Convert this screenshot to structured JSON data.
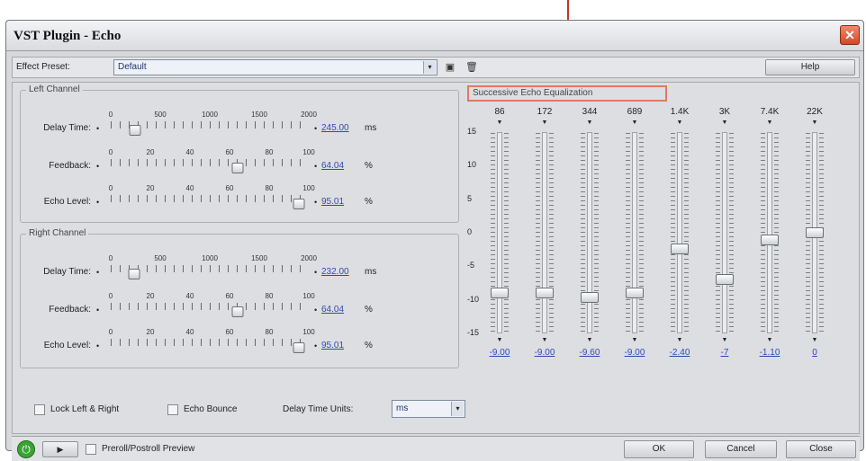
{
  "window": {
    "title": "VST Plugin - Echo",
    "close_glyph": "✕"
  },
  "preset": {
    "label": "Effect Preset:",
    "value": "Default",
    "arrow": "▾",
    "save_icon": "▣",
    "delete_icon": "🗑",
    "help_label": "Help"
  },
  "left_channel": {
    "title": "Left Channel",
    "delay": {
      "label": "Delay Time:",
      "scale": [
        "0",
        "500",
        "1000",
        "1500",
        "2000"
      ],
      "value": "245.00",
      "unit": "ms",
      "level": 0.1225
    },
    "feedback": {
      "label": "Feedback:",
      "scale": [
        "0",
        "20",
        "40",
        "60",
        "80",
        "100"
      ],
      "value": "64.04",
      "unit": "%",
      "level": 0.6404
    },
    "echo_level": {
      "label": "Echo Level:",
      "scale": [
        "0",
        "20",
        "40",
        "60",
        "80",
        "100"
      ],
      "value": "95.01",
      "unit": "%",
      "level": 0.9501
    }
  },
  "right_channel": {
    "title": "Right Channel",
    "delay": {
      "label": "Delay Time:",
      "scale": [
        "0",
        "500",
        "1000",
        "1500",
        "2000"
      ],
      "value": "232.00",
      "unit": "ms",
      "level": 0.116
    },
    "feedback": {
      "label": "Feedback:",
      "scale": [
        "0",
        "20",
        "40",
        "60",
        "80",
        "100"
      ],
      "value": "64.04",
      "unit": "%",
      "level": 0.6404
    },
    "echo_level": {
      "label": "Echo Level:",
      "scale": [
        "0",
        "20",
        "40",
        "60",
        "80",
        "100"
      ],
      "value": "95.01",
      "unit": "%",
      "level": 0.9501
    }
  },
  "eq": {
    "title": "Successive Echo Equalization",
    "db_labels": [
      "15",
      "10",
      "5",
      "0",
      "-5",
      "-10",
      "-15"
    ],
    "bands": [
      {
        "freq": "86",
        "value": "-9.00",
        "level": -9.0
      },
      {
        "freq": "172",
        "value": "-9.00",
        "level": -9.0
      },
      {
        "freq": "344",
        "value": "-9.60",
        "level": -9.6
      },
      {
        "freq": "689",
        "value": "-9.00",
        "level": -9.0
      },
      {
        "freq": "1.4K",
        "value": "-2.40",
        "level": -2.4
      },
      {
        "freq": "3K",
        "value": "-7",
        "level": -7.0
      },
      {
        "freq": "7.4K",
        "value": "-1.10",
        "level": -1.1
      },
      {
        "freq": "22K",
        "value": "0",
        "level": 0.0
      }
    ]
  },
  "options": {
    "lock_label": "Lock Left & Right",
    "bounce_label": "Echo Bounce",
    "units_label": "Delay Time Units:",
    "units_value": "ms",
    "units_arrow": "▾"
  },
  "footer": {
    "power_glyph": "⏻",
    "play_glyph": "▶",
    "preroll_label": "Preroll/Postroll Preview",
    "ok_label": "OK",
    "cancel_label": "Cancel",
    "close_label": "Close"
  }
}
